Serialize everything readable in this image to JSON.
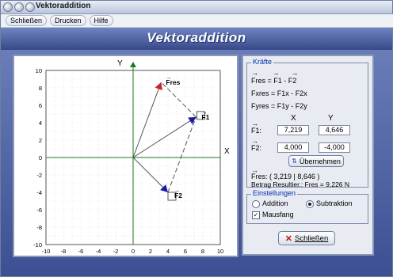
{
  "window": {
    "title": "Vektoraddition"
  },
  "menu": {
    "items": [
      "Schließen",
      "Drucken",
      "Hilfe"
    ]
  },
  "header": {
    "title": "Vektoraddition"
  },
  "graph": {
    "axis_x_label": "X",
    "axis_y_label": "Y",
    "x_ticks": [
      "-10",
      "-8",
      "-6",
      "-4",
      "-2",
      "0",
      "2",
      "4",
      "6",
      "8",
      "10"
    ],
    "y_ticks": [
      "10",
      "8",
      "6",
      "4",
      "2",
      "0",
      "-2",
      "-4",
      "-6",
      "-8",
      "-10"
    ],
    "vectors": {
      "f1": {
        "label": "F1",
        "x": 7.219,
        "y": 4.646
      },
      "f2": {
        "label": "F2",
        "x": 4.0,
        "y": -4.0
      },
      "fres": {
        "label": "Fres",
        "x": 3.219,
        "y": 8.646
      }
    },
    "colors": {
      "axis": "#1b7a1b",
      "vector": "#555555",
      "fres_head": "#cc2222",
      "f_head": "#1a1aa8"
    }
  },
  "kraefte": {
    "title": "Kräfte",
    "formulas": [
      "Fres = F1 - F2",
      "Fxres = F1x - F2x",
      "Fyres = F1y - F2y"
    ],
    "col_x": "X",
    "col_y": "Y",
    "f1_label": "F1:",
    "f1_x": "7,219",
    "f1_y": "4,646",
    "f2_label": "F2:",
    "f2_x": "4,000",
    "f2_y": "-4,000",
    "apply_button": "Übernehmen",
    "result_line": "Fres:  ( 3,219 | 8,646 )",
    "magnitude_line": "Betrag Resultier.: Fres = 9,226 N"
  },
  "settings": {
    "title": "Einstellungen",
    "addition_label": "Addition",
    "subtraktion_label": "Subtraktion",
    "mausfang_label": "Mausfang",
    "selected_mode": "subtraktion",
    "mausfang_checked": true
  },
  "close_button": {
    "label": "Schließen"
  }
}
